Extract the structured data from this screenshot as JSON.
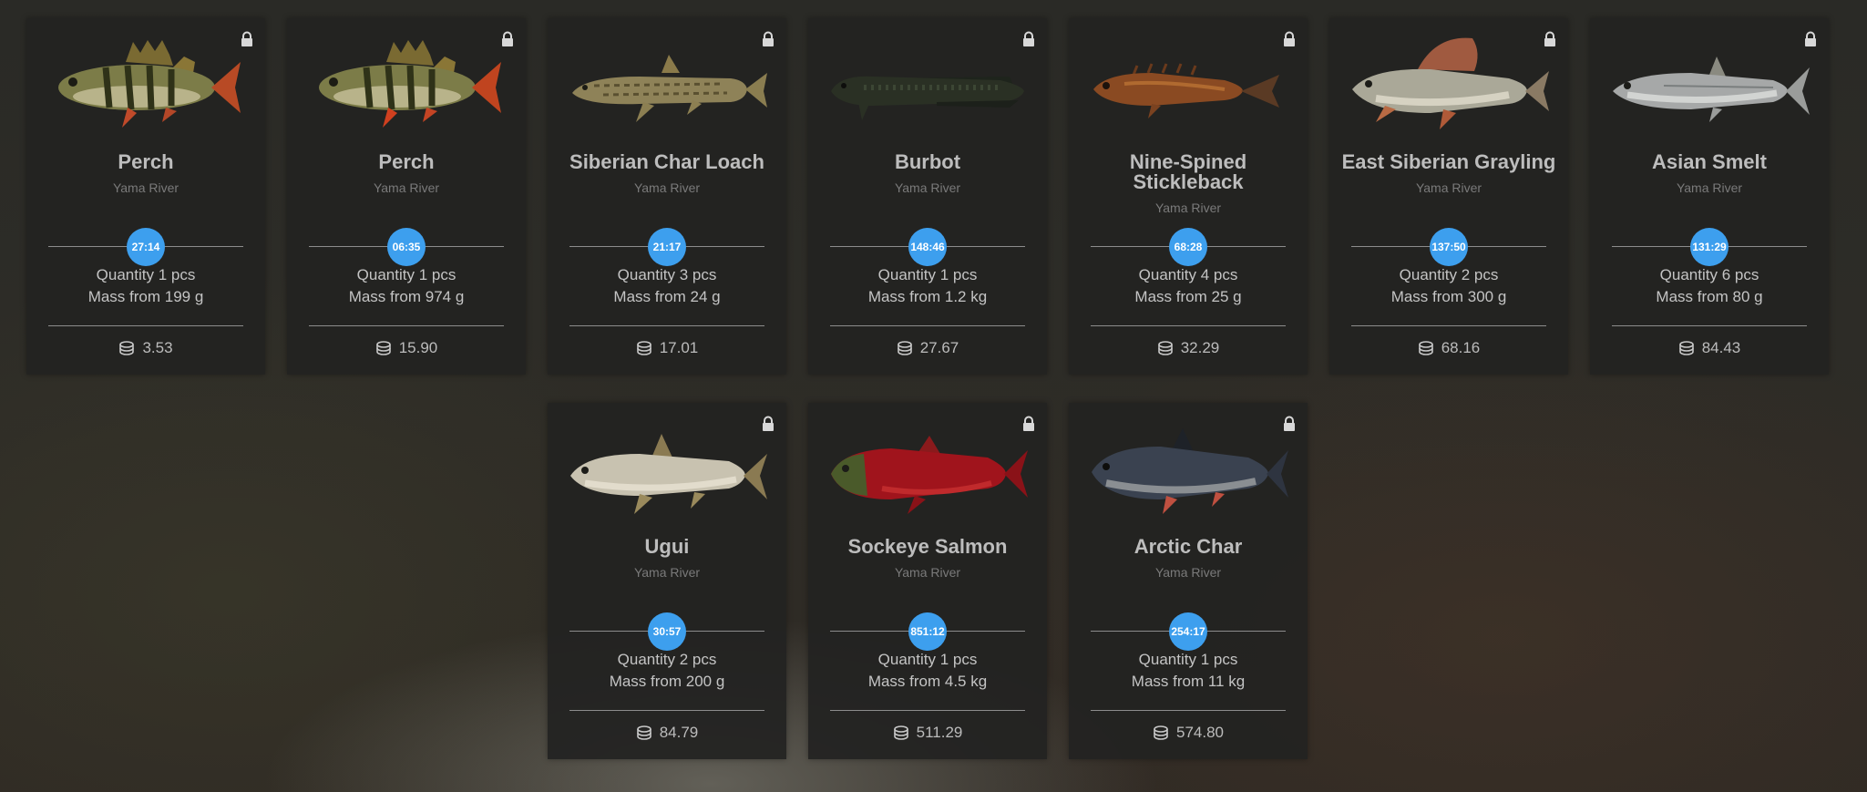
{
  "cards": [
    {
      "name": "Perch",
      "location": "Yama River",
      "timer": "27:14",
      "quantity": "Quantity 1 pcs",
      "mass": "Mass from 199 g",
      "price": "3.53",
      "fish_icon": "perch-fish-icon"
    },
    {
      "name": "Perch",
      "location": "Yama River",
      "timer": "06:35",
      "quantity": "Quantity 1 pcs",
      "mass": "Mass from 974 g",
      "price": "15.90",
      "fish_icon": "perch-fish-icon"
    },
    {
      "name": "Siberian Char Loach",
      "location": "Yama River",
      "timer": "21:17",
      "quantity": "Quantity 3 pcs",
      "mass": "Mass from 24 g",
      "price": "17.01",
      "fish_icon": "loach-fish-icon"
    },
    {
      "name": "Burbot",
      "location": "Yama River",
      "timer": "148:46",
      "quantity": "Quantity 1 pcs",
      "mass": "Mass from 1.2 kg",
      "price": "27.67",
      "fish_icon": "burbot-fish-icon"
    },
    {
      "name": "Nine-Spined Stickleback",
      "location": "Yama River",
      "timer": "68:28",
      "quantity": "Quantity 4 pcs",
      "mass": "Mass from 25 g",
      "price": "32.29",
      "fish_icon": "stickleback-fish-icon"
    },
    {
      "name": "East Siberian Grayling",
      "location": "Yama River",
      "timer": "137:50",
      "quantity": "Quantity 2 pcs",
      "mass": "Mass from 300 g",
      "price": "68.16",
      "fish_icon": "grayling-fish-icon"
    },
    {
      "name": "Asian Smelt",
      "location": "Yama River",
      "timer": "131:29",
      "quantity": "Quantity 6 pcs",
      "mass": "Mass from 80 g",
      "price": "84.43",
      "fish_icon": "smelt-fish-icon"
    },
    {
      "name": "Ugui",
      "location": "Yama River",
      "timer": "30:57",
      "quantity": "Quantity 2 pcs",
      "mass": "Mass from 200 g",
      "price": "84.79",
      "fish_icon": "ugui-fish-icon"
    },
    {
      "name": "Sockeye Salmon",
      "location": "Yama River",
      "timer": "851:12",
      "quantity": "Quantity 1 pcs",
      "mass": "Mass from 4.5 kg",
      "price": "511.29",
      "fish_icon": "sockeye-salmon-fish-icon"
    },
    {
      "name": "Arctic Char",
      "location": "Yama River",
      "timer": "254:17",
      "quantity": "Quantity 1 pcs",
      "mass": "Mass from 11 kg",
      "price": "574.80",
      "fish_icon": "arctic-char-fish-icon"
    }
  ],
  "icons": {
    "lock": "lock-icon",
    "currency": "coins-icon"
  },
  "colors": {
    "timer_badge": "#3d9fee",
    "card_bg": "#222221",
    "title": "#bdbdbd",
    "subtitle": "#7a7a7a"
  }
}
